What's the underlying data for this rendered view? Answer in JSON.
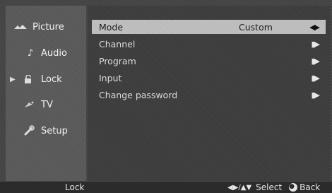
{
  "sidebar": {
    "items": [
      {
        "label": "Picture",
        "icon": "picture-icon"
      },
      {
        "label": "Audio",
        "icon": "audio-note-icon"
      },
      {
        "label": "Lock",
        "icon": "lock-icon",
        "selected": true
      },
      {
        "label": "TV",
        "icon": "tv-satellite-icon"
      },
      {
        "label": "Setup",
        "icon": "setup-wrench-icon"
      }
    ]
  },
  "lock_menu": {
    "rows": [
      {
        "label": "Mode",
        "value": "Custom"
      },
      {
        "label": "Channel",
        "value": ""
      },
      {
        "label": "Program",
        "value": ""
      },
      {
        "label": "Input",
        "value": ""
      },
      {
        "label": "Change password",
        "value": ""
      }
    ]
  },
  "status_bar": {
    "title": "Lock",
    "nav_hint": "Select",
    "back_label": "Back"
  },
  "colors": {
    "background": "#444444",
    "sidebar": "#575757",
    "selected_row": "#b9b9b9",
    "status_bar": "#2b2b2b"
  }
}
